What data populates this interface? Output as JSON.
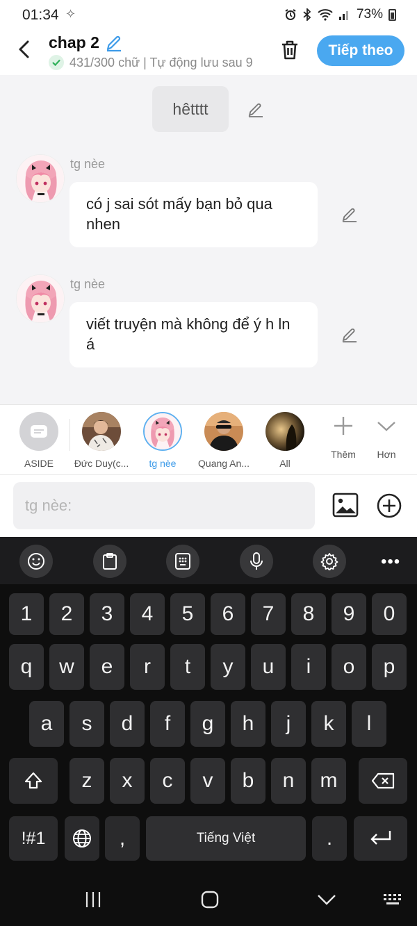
{
  "status": {
    "time": "01:34",
    "battery": "73%"
  },
  "header": {
    "title": "chap 2",
    "subtitle": "431/300 chữ | Tự động lưu sau 9",
    "next_label": "Tiếp theo"
  },
  "chat": {
    "narration": "hêtttt",
    "messages": [
      {
        "speaker": "tg nèe",
        "text": "có j sai sót mấy bạn bỏ qua nhen"
      },
      {
        "speaker": "tg nèe",
        "text": "viết truyện mà không để ý h ln á"
      }
    ]
  },
  "characters": [
    {
      "label": "ASIDE",
      "active": false
    },
    {
      "label": "Đức Duy(c...",
      "active": false
    },
    {
      "label": "tg nèe",
      "active": true
    },
    {
      "label": "Quang An...",
      "active": false
    },
    {
      "label": "All",
      "active": false
    }
  ],
  "char_actions": {
    "more_label": "Thêm",
    "expand_label": "Hơn"
  },
  "input": {
    "placeholder": "tg nèe:"
  },
  "keyboard": {
    "row_numbers": [
      "1",
      "2",
      "3",
      "4",
      "5",
      "6",
      "7",
      "8",
      "9",
      "0"
    ],
    "row_1": [
      "q",
      "w",
      "e",
      "r",
      "t",
      "y",
      "u",
      "i",
      "o",
      "p"
    ],
    "row_2": [
      "a",
      "s",
      "d",
      "f",
      "g",
      "h",
      "j",
      "k",
      "l"
    ],
    "row_3": [
      "z",
      "x",
      "c",
      "v",
      "b",
      "n",
      "m"
    ],
    "symbols_label": "!#1",
    "comma": ",",
    "space_label": "Tiếng Việt",
    "period": "."
  }
}
